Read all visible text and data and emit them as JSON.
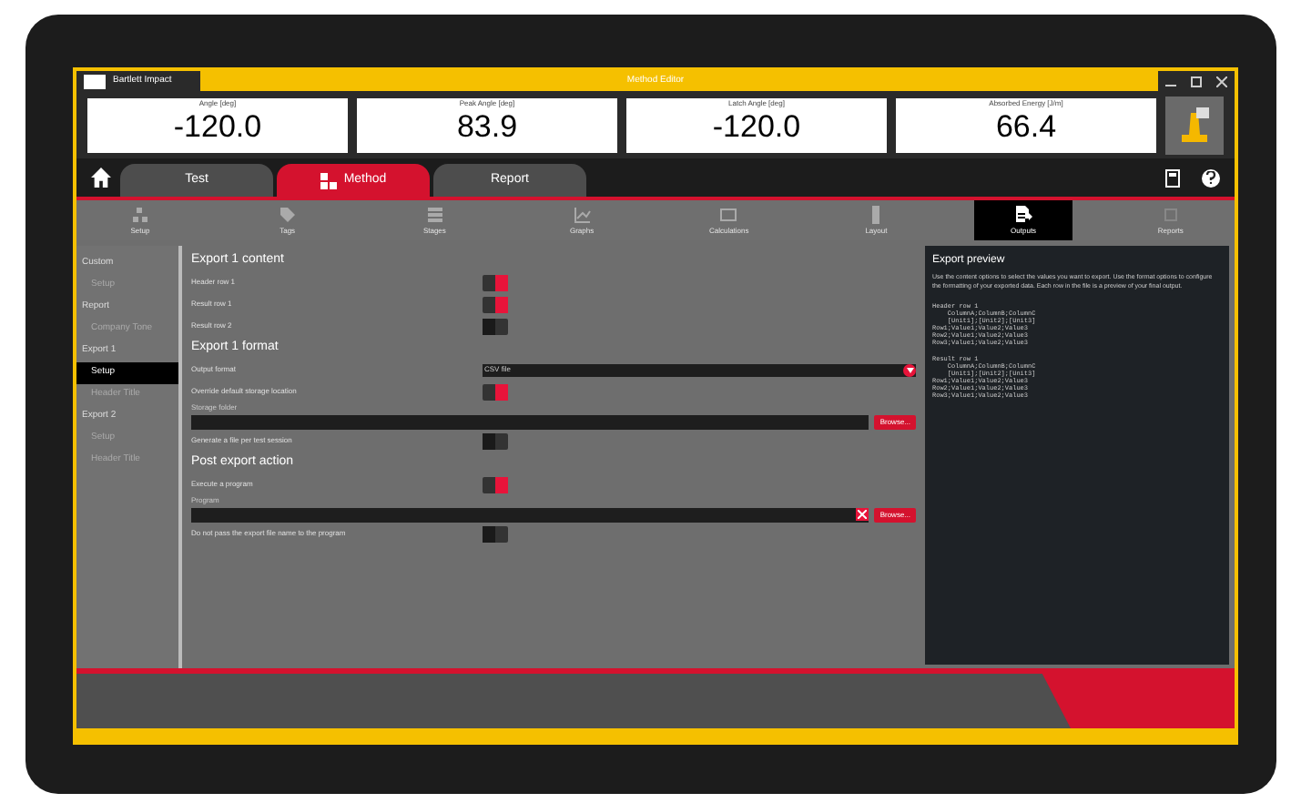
{
  "window": {
    "app_name": "Bartlett Impact",
    "title": "Method Editor"
  },
  "readouts": [
    {
      "label": "Angle [deg]",
      "value": "-120.0"
    },
    {
      "label": "Peak Angle [deg]",
      "value": "83.9"
    },
    {
      "label": "Latch Angle [deg]",
      "value": "-120.0"
    },
    {
      "label": "Absorbed Energy [J/m]",
      "value": "66.4"
    }
  ],
  "tabs": [
    {
      "label": "Test",
      "selected": false
    },
    {
      "label": "Method",
      "selected": true
    },
    {
      "label": "Report",
      "selected": false
    }
  ],
  "toolbar": [
    {
      "label": "Setup",
      "selected": false
    },
    {
      "label": "Tags",
      "selected": false
    },
    {
      "label": "Stages",
      "selected": false
    },
    {
      "label": "Graphs",
      "selected": false
    },
    {
      "label": "Calculations",
      "selected": false
    },
    {
      "label": "Layout",
      "selected": false
    },
    {
      "label": "Outputs",
      "selected": true
    },
    {
      "label": "Reports",
      "selected": false
    }
  ],
  "sidebar": {
    "items": [
      {
        "kind": "section",
        "label": "Custom",
        "selected": false
      },
      {
        "kind": "item",
        "label": "Setup",
        "selected": false
      },
      {
        "kind": "section",
        "label": "Report",
        "selected": false
      },
      {
        "kind": "item",
        "label": "Company Tone",
        "selected": false
      },
      {
        "kind": "section",
        "label": "Export 1",
        "selected": false
      },
      {
        "kind": "item",
        "label": "Setup",
        "selected": true
      },
      {
        "kind": "item",
        "label": "Header Title",
        "selected": false
      },
      {
        "kind": "section",
        "label": "Export 2",
        "selected": false
      },
      {
        "kind": "item",
        "label": "Setup",
        "selected": false
      },
      {
        "kind": "item",
        "label": "Header Title",
        "selected": false
      }
    ]
  },
  "form": [
    {
      "kind": "heading",
      "label": "Export 1 content"
    },
    {
      "kind": "toggle",
      "label": "Header row 1",
      "on": true
    },
    {
      "kind": "toggle",
      "label": "Result row 1",
      "on": true
    },
    {
      "kind": "toggle",
      "label": "Result row 2",
      "on": false
    },
    {
      "kind": "heading",
      "label": "Export 1 format"
    },
    {
      "kind": "select",
      "label": "Output format",
      "value": "CSV file"
    },
    {
      "kind": "toggle",
      "label": "Override default storage location",
      "on": true
    },
    {
      "kind": "path",
      "label": "Storage folder",
      "button": "Browse...",
      "clearable": false
    },
    {
      "kind": "toggle",
      "label": "Generate a file per test session",
      "on": false
    },
    {
      "kind": "heading",
      "label": "Post export action"
    },
    {
      "kind": "toggle",
      "label": "Execute a program",
      "on": true
    },
    {
      "kind": "path",
      "label": "Program",
      "button": "Browse...",
      "clearable": true
    },
    {
      "kind": "toggle",
      "label": "Do not pass the export file name to the program",
      "on": false
    }
  ],
  "preview": {
    "title": "Export preview",
    "text": "Use the content options to select the values you want to export. Use the format options to configure the formatting of your exported data. Each row in the file is a preview of your final output.",
    "code_blocks": [
      [
        "Header row 1",
        "    ColumnA;ColumnB;ColumnC",
        "    [Unit1];[Unit2];[Unit3]",
        "Row1;Value1;Value2;Value3",
        "Row2;Value1;Value2;Value3",
        "Row3;Value1;Value2;Value3"
      ],
      [
        "Result row 1",
        "    ColumnA;ColumnB;ColumnC",
        "    [Unit1];[Unit2];[Unit3]",
        "Row1;Value1;Value2;Value3",
        "Row2;Value1;Value2;Value3",
        "Row3;Value1;Value2;Value3"
      ]
    ]
  }
}
